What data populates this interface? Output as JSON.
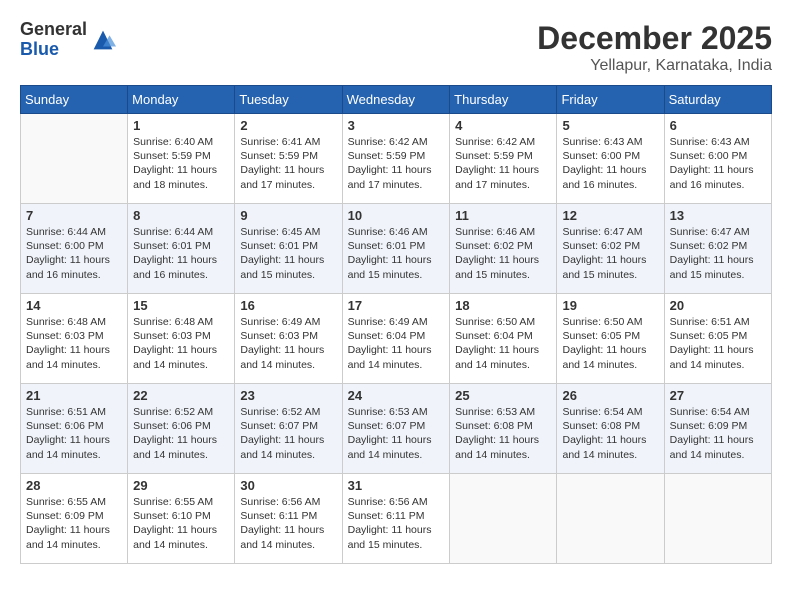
{
  "header": {
    "logo": {
      "general": "General",
      "blue": "Blue"
    },
    "month": "December 2025",
    "location": "Yellapur, Karnataka, India"
  },
  "days_of_week": [
    "Sunday",
    "Monday",
    "Tuesday",
    "Wednesday",
    "Thursday",
    "Friday",
    "Saturday"
  ],
  "weeks": [
    [
      {
        "day": "",
        "sunrise": "",
        "sunset": "",
        "daylight": ""
      },
      {
        "day": "1",
        "sunrise": "Sunrise: 6:40 AM",
        "sunset": "Sunset: 5:59 PM",
        "daylight": "Daylight: 11 hours and 18 minutes."
      },
      {
        "day": "2",
        "sunrise": "Sunrise: 6:41 AM",
        "sunset": "Sunset: 5:59 PM",
        "daylight": "Daylight: 11 hours and 17 minutes."
      },
      {
        "day": "3",
        "sunrise": "Sunrise: 6:42 AM",
        "sunset": "Sunset: 5:59 PM",
        "daylight": "Daylight: 11 hours and 17 minutes."
      },
      {
        "day": "4",
        "sunrise": "Sunrise: 6:42 AM",
        "sunset": "Sunset: 5:59 PM",
        "daylight": "Daylight: 11 hours and 17 minutes."
      },
      {
        "day": "5",
        "sunrise": "Sunrise: 6:43 AM",
        "sunset": "Sunset: 6:00 PM",
        "daylight": "Daylight: 11 hours and 16 minutes."
      },
      {
        "day": "6",
        "sunrise": "Sunrise: 6:43 AM",
        "sunset": "Sunset: 6:00 PM",
        "daylight": "Daylight: 11 hours and 16 minutes."
      }
    ],
    [
      {
        "day": "7",
        "sunrise": "Sunrise: 6:44 AM",
        "sunset": "Sunset: 6:00 PM",
        "daylight": "Daylight: 11 hours and 16 minutes."
      },
      {
        "day": "8",
        "sunrise": "Sunrise: 6:44 AM",
        "sunset": "Sunset: 6:01 PM",
        "daylight": "Daylight: 11 hours and 16 minutes."
      },
      {
        "day": "9",
        "sunrise": "Sunrise: 6:45 AM",
        "sunset": "Sunset: 6:01 PM",
        "daylight": "Daylight: 11 hours and 15 minutes."
      },
      {
        "day": "10",
        "sunrise": "Sunrise: 6:46 AM",
        "sunset": "Sunset: 6:01 PM",
        "daylight": "Daylight: 11 hours and 15 minutes."
      },
      {
        "day": "11",
        "sunrise": "Sunrise: 6:46 AM",
        "sunset": "Sunset: 6:02 PM",
        "daylight": "Daylight: 11 hours and 15 minutes."
      },
      {
        "day": "12",
        "sunrise": "Sunrise: 6:47 AM",
        "sunset": "Sunset: 6:02 PM",
        "daylight": "Daylight: 11 hours and 15 minutes."
      },
      {
        "day": "13",
        "sunrise": "Sunrise: 6:47 AM",
        "sunset": "Sunset: 6:02 PM",
        "daylight": "Daylight: 11 hours and 15 minutes."
      }
    ],
    [
      {
        "day": "14",
        "sunrise": "Sunrise: 6:48 AM",
        "sunset": "Sunset: 6:03 PM",
        "daylight": "Daylight: 11 hours and 14 minutes."
      },
      {
        "day": "15",
        "sunrise": "Sunrise: 6:48 AM",
        "sunset": "Sunset: 6:03 PM",
        "daylight": "Daylight: 11 hours and 14 minutes."
      },
      {
        "day": "16",
        "sunrise": "Sunrise: 6:49 AM",
        "sunset": "Sunset: 6:03 PM",
        "daylight": "Daylight: 11 hours and 14 minutes."
      },
      {
        "day": "17",
        "sunrise": "Sunrise: 6:49 AM",
        "sunset": "Sunset: 6:04 PM",
        "daylight": "Daylight: 11 hours and 14 minutes."
      },
      {
        "day": "18",
        "sunrise": "Sunrise: 6:50 AM",
        "sunset": "Sunset: 6:04 PM",
        "daylight": "Daylight: 11 hours and 14 minutes."
      },
      {
        "day": "19",
        "sunrise": "Sunrise: 6:50 AM",
        "sunset": "Sunset: 6:05 PM",
        "daylight": "Daylight: 11 hours and 14 minutes."
      },
      {
        "day": "20",
        "sunrise": "Sunrise: 6:51 AM",
        "sunset": "Sunset: 6:05 PM",
        "daylight": "Daylight: 11 hours and 14 minutes."
      }
    ],
    [
      {
        "day": "21",
        "sunrise": "Sunrise: 6:51 AM",
        "sunset": "Sunset: 6:06 PM",
        "daylight": "Daylight: 11 hours and 14 minutes."
      },
      {
        "day": "22",
        "sunrise": "Sunrise: 6:52 AM",
        "sunset": "Sunset: 6:06 PM",
        "daylight": "Daylight: 11 hours and 14 minutes."
      },
      {
        "day": "23",
        "sunrise": "Sunrise: 6:52 AM",
        "sunset": "Sunset: 6:07 PM",
        "daylight": "Daylight: 11 hours and 14 minutes."
      },
      {
        "day": "24",
        "sunrise": "Sunrise: 6:53 AM",
        "sunset": "Sunset: 6:07 PM",
        "daylight": "Daylight: 11 hours and 14 minutes."
      },
      {
        "day": "25",
        "sunrise": "Sunrise: 6:53 AM",
        "sunset": "Sunset: 6:08 PM",
        "daylight": "Daylight: 11 hours and 14 minutes."
      },
      {
        "day": "26",
        "sunrise": "Sunrise: 6:54 AM",
        "sunset": "Sunset: 6:08 PM",
        "daylight": "Daylight: 11 hours and 14 minutes."
      },
      {
        "day": "27",
        "sunrise": "Sunrise: 6:54 AM",
        "sunset": "Sunset: 6:09 PM",
        "daylight": "Daylight: 11 hours and 14 minutes."
      }
    ],
    [
      {
        "day": "28",
        "sunrise": "Sunrise: 6:55 AM",
        "sunset": "Sunset: 6:09 PM",
        "daylight": "Daylight: 11 hours and 14 minutes."
      },
      {
        "day": "29",
        "sunrise": "Sunrise: 6:55 AM",
        "sunset": "Sunset: 6:10 PM",
        "daylight": "Daylight: 11 hours and 14 minutes."
      },
      {
        "day": "30",
        "sunrise": "Sunrise: 6:56 AM",
        "sunset": "Sunset: 6:11 PM",
        "daylight": "Daylight: 11 hours and 14 minutes."
      },
      {
        "day": "31",
        "sunrise": "Sunrise: 6:56 AM",
        "sunset": "Sunset: 6:11 PM",
        "daylight": "Daylight: 11 hours and 15 minutes."
      },
      {
        "day": "",
        "sunrise": "",
        "sunset": "",
        "daylight": ""
      },
      {
        "day": "",
        "sunrise": "",
        "sunset": "",
        "daylight": ""
      },
      {
        "day": "",
        "sunrise": "",
        "sunset": "",
        "daylight": ""
      }
    ]
  ]
}
